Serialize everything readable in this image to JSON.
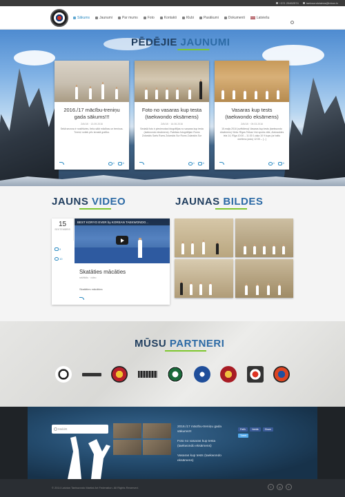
{
  "topbar": {
    "phone": "+371 29452574",
    "email": "taekwondolatvia@inbox.lv"
  },
  "nav": {
    "items": [
      {
        "label": "Sākums",
        "icon": "home-icon"
      },
      {
        "label": "Jaunumi",
        "icon": "megaphone-icon"
      },
      {
        "label": "Par mums",
        "icon": "fighter-icon"
      },
      {
        "label": "Foto",
        "icon": "camera-icon"
      },
      {
        "label": "Kontakti",
        "icon": "contact-icon"
      },
      {
        "label": "Klubi",
        "icon": "club-icon"
      },
      {
        "label": "Pasākumi",
        "icon": "event-icon"
      },
      {
        "label": "Dokumenti",
        "icon": "document-icon"
      },
      {
        "label": "Latviešu",
        "icon": "latvia-flag-icon"
      }
    ],
    "active_index": 0
  },
  "hero": {
    "title_a": "PĒDĒJIE",
    "title_b": "JAUNUMI",
    "cards": [
      {
        "title": "2016./17 mācību-treniņu gada sākums!!!",
        "meta": "ZAVUK · 13.09.2016",
        "body": "Sekā sezona ir noslēdzies, tieko sākt mācības un treniņus. Treniņi notiek pēc ierastā grafika.",
        "likes": "0",
        "comments": "0"
      },
      {
        "title": "Foto no vasaras kup testa (taekwondo eksāmens)",
        "meta": "ZAVUK · 16.06.2016",
        "body": "Sedašā foto ir pievienotas fotogrāfijas no vasaras kup testa (taekwondo eksāmens). Pateikas fotogrāfijam Rums Zolarskis Sarts Rums Zolarskis Sur Rums Zolarskis Sur",
        "likes": "0",
        "comments": "0"
      },
      {
        "title": "Vasaras kup tests (taekwondo eksāmens)",
        "meta": "ZAVUK · 09.03.2016",
        "body": "15.maijs 2016 (svētdiena) Vasaras kup tests (taekwondo eksāmens) Vieta: Rīgas Teikas Vsk sporta zāle, Aizkraukles iela 14, Rīga 10:00 – 11:30 1.daļa 10 9 kups (ar baltu dzelteno jostu) 12:00 – [...]",
        "likes": "0",
        "comments": "0"
      }
    ]
  },
  "video_section": {
    "title_a": "JAUNS",
    "title_b": "VIDEO",
    "day": "15",
    "month": "SEKTEMBRIS",
    "comments": "0",
    "likes": "10",
    "video_title": "BEST KORYO EVER by KOREAN TAEKWONDO...",
    "post_title": "Skatāties mācāties",
    "meta": "rašēkšts · video",
    "text": "Skatāties mācāties"
  },
  "photos_section": {
    "title_a": "JAUNAS",
    "title_b": "BILDES"
  },
  "partners": {
    "title_a": "MŪSU",
    "title_b": "PARTNERI",
    "logos": [
      "budoshop-logo",
      "tape-logo",
      "club-crest-logo",
      "taekwondo-academy-logo",
      "globe-federation-logo",
      "blue-emblem-logo",
      "red-badge-logo",
      "rescue-logo",
      "flag-emblem-logo"
    ]
  },
  "footer": {
    "search_placeholder": "Meklēt",
    "links": [
      "2016./17 mācību-treniņu gada sākums!!!",
      "Foto no vasaras kup testa (taekwondo eksāmens)",
      "Vasaras kup tests (taekwondo eksāmens)"
    ],
    "social": [
      "Patīk",
      "Vairāk",
      "Share",
      "Tweet"
    ],
    "copyright": "© 2014 Latvian Taekwondo Martial Art Federation. All Rights Reserved."
  },
  "colors": {
    "accent_blue": "#2a8ac2",
    "title_navy": "#1f3d5e",
    "underline_green": "#7ec72e"
  }
}
